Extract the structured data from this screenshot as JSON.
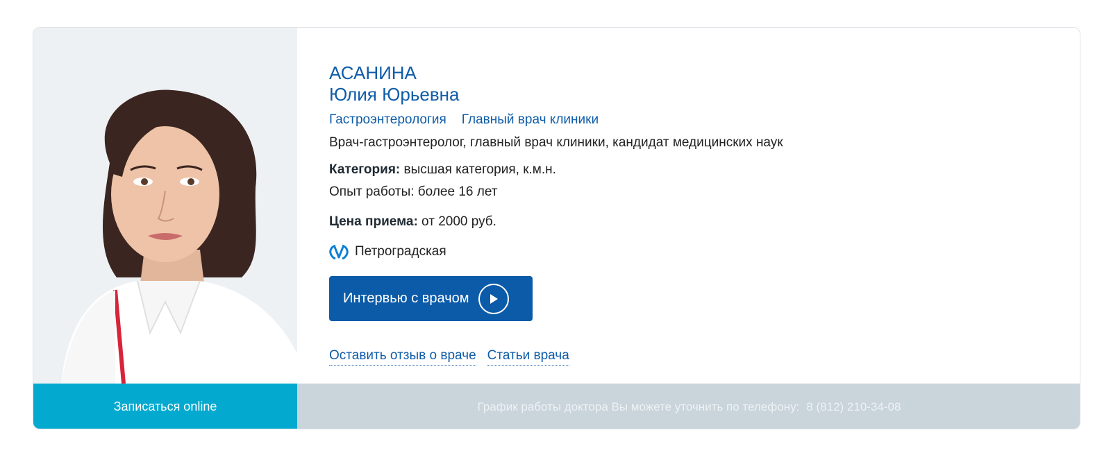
{
  "doctor": {
    "surname": "АСАНИНА",
    "first_names": "Юлия Юрьевна",
    "tags": [
      "Гастроэнтерология",
      "Главный врач клиники"
    ],
    "description": "Врач-гастроэнтеролог, главный врач клиники, кандидат медицинских наук",
    "category_label": "Категория:",
    "category_value": " высшая категория, к.м.н.",
    "experience": "Опыт работы: более 16 лет",
    "price_label": "Цена приема:",
    "price_value": " от 2000 руб.",
    "metro_icon": "metro-logo-icon",
    "metro_station": "Петроградская"
  },
  "buttons": {
    "interview": "Интервью с врачом",
    "book_online": "Записаться online"
  },
  "links": {
    "review": "Оставить отзыв о враче",
    "articles": "Статьи врача"
  },
  "schedule": {
    "text": "График работы доктора Вы можете уточнить по телефону:",
    "phone": "8 (812) 210-34-08"
  },
  "colors": {
    "brand_blue": "#0c5ba8",
    "book_cyan": "#04a9d0",
    "schedule_gray": "#c9d4db"
  }
}
